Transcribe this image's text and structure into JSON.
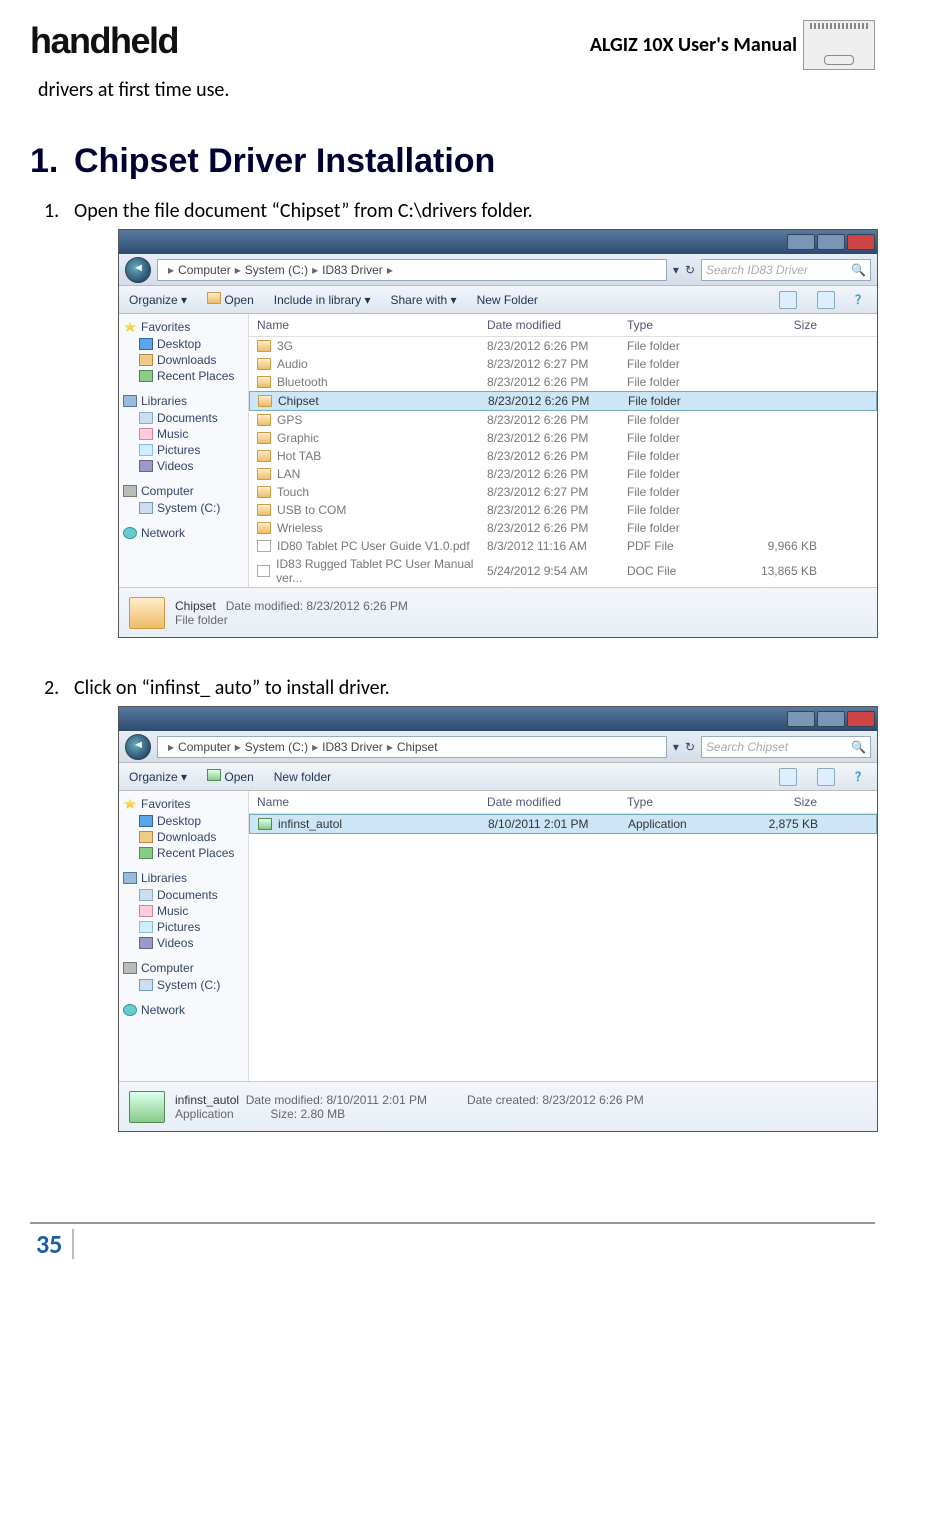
{
  "header": {
    "brand": "handheld",
    "manual_title": "ALGIZ 10X User's Manual"
  },
  "intro_text": "drivers at first time use.",
  "section": {
    "number": "1.",
    "title": "Chipset Driver Installation"
  },
  "steps": {
    "s1_num": "1.",
    "s1_text": "Open the file document “Chipset” from C:\\drivers folder.",
    "s2_num": "2.",
    "s2_text": "Click on “infinst_ auto” to install driver."
  },
  "explorer1": {
    "breadcrumb": [
      "Computer",
      "System (C:)",
      "ID83 Driver"
    ],
    "search_placeholder": "Search ID83 Driver",
    "cmdbar": {
      "organize": "Organize ▾",
      "open": "Open",
      "include": "Include in library ▾",
      "share": "Share with ▾",
      "newfolder": "New Folder"
    },
    "columns": {
      "name": "Name",
      "date": "Date modified",
      "type": "Type",
      "size": "Size"
    },
    "nav": {
      "favorites": "Favorites",
      "desktop": "Desktop",
      "downloads": "Downloads",
      "recent": "Recent Places",
      "libraries": "Libraries",
      "documents": "Documents",
      "music": "Music",
      "pictures": "Pictures",
      "videos": "Videos",
      "computer": "Computer",
      "systemc": "System (C:)",
      "network": "Network"
    },
    "rows": [
      {
        "name": "3G",
        "date": "8/23/2012 6:26 PM",
        "type": "File folder",
        "size": "",
        "icon": "fold",
        "sel": false
      },
      {
        "name": "Audio",
        "date": "8/23/2012 6:27 PM",
        "type": "File folder",
        "size": "",
        "icon": "fold",
        "sel": false
      },
      {
        "name": "Bluetooth",
        "date": "8/23/2012 6:26 PM",
        "type": "File folder",
        "size": "",
        "icon": "fold",
        "sel": false
      },
      {
        "name": "Chipset",
        "date": "8/23/2012 6:26 PM",
        "type": "File folder",
        "size": "",
        "icon": "fold",
        "sel": true
      },
      {
        "name": "GPS",
        "date": "8/23/2012 6:26 PM",
        "type": "File folder",
        "size": "",
        "icon": "fold",
        "sel": false
      },
      {
        "name": "Graphic",
        "date": "8/23/2012 6:26 PM",
        "type": "File folder",
        "size": "",
        "icon": "fold",
        "sel": false
      },
      {
        "name": "Hot TAB",
        "date": "8/23/2012 6:26 PM",
        "type": "File folder",
        "size": "",
        "icon": "fold",
        "sel": false
      },
      {
        "name": "LAN",
        "date": "8/23/2012 6:26 PM",
        "type": "File folder",
        "size": "",
        "icon": "fold",
        "sel": false
      },
      {
        "name": "Touch",
        "date": "8/23/2012 6:27 PM",
        "type": "File folder",
        "size": "",
        "icon": "fold",
        "sel": false
      },
      {
        "name": "USB to COM",
        "date": "8/23/2012 6:26 PM",
        "type": "File folder",
        "size": "",
        "icon": "fold",
        "sel": false
      },
      {
        "name": "Wrieless",
        "date": "8/23/2012 6:26 PM",
        "type": "File folder",
        "size": "",
        "icon": "fold",
        "sel": false
      },
      {
        "name": "ID80 Tablet PC User Guide V1.0.pdf",
        "date": "8/3/2012 11:16 AM",
        "type": "PDF File",
        "size": "9,966 KB",
        "icon": "file",
        "sel": false
      },
      {
        "name": "ID83 Rugged Tablet PC  User Manual ver...",
        "date": "5/24/2012 9:54 AM",
        "type": "DOC File",
        "size": "13,865 KB",
        "icon": "file",
        "sel": false
      }
    ],
    "details": {
      "name": "Chipset",
      "meta1_label": "Date modified:",
      "meta1_val": "8/23/2012 6:26 PM",
      "subtype": "File folder"
    }
  },
  "explorer2": {
    "breadcrumb": [
      "Computer",
      "System (C:)",
      "ID83 Driver",
      "Chipset"
    ],
    "search_placeholder": "Search Chipset",
    "cmdbar": {
      "organize": "Organize ▾",
      "open": "Open",
      "newfolder": "New folder"
    },
    "columns": {
      "name": "Name",
      "date": "Date modified",
      "type": "Type",
      "size": "Size"
    },
    "rows": [
      {
        "name": "infinst_autol",
        "date": "8/10/2011 2:01 PM",
        "type": "Application",
        "size": "2,875 KB",
        "icon": "app",
        "sel": true
      }
    ],
    "details": {
      "name": "infinst_autol",
      "meta1_label": "Date modified:",
      "meta1_val": "8/10/2011 2:01 PM",
      "meta2_label": "Date created:",
      "meta2_val": "8/23/2012 6:26 PM",
      "subtype": "Application",
      "size_label": "Size:",
      "size_val": "2.80 MB"
    }
  },
  "page_number": "35"
}
